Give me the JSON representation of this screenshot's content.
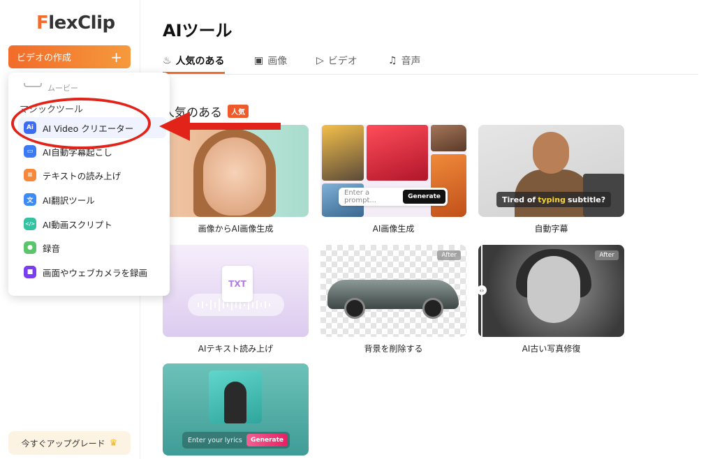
{
  "brand": {
    "logo_text": "lexClip",
    "logo_initial": "F"
  },
  "sidebar": {
    "create_label": "ビデオの作成",
    "create_icon": "plus-icon",
    "upgrade_label": "今すぐアップグレード",
    "upgrade_icon": "crown-icon"
  },
  "dropdown": {
    "movie_label": "ムービー",
    "section_label": "マジックツール",
    "items": [
      {
        "label": "AI Video クリエーター",
        "icon": "ai-video-icon",
        "color": "#3b6cf6",
        "glyph": "Ai"
      },
      {
        "label": "AI自動字幕起こし",
        "icon": "subtitle-icon",
        "color": "#3b7cf6",
        "glyph": "▭"
      },
      {
        "label": "テキストの読み上げ",
        "icon": "tts-icon",
        "color": "#f5883a",
        "glyph": "≡"
      },
      {
        "label": "AI翻訳ツール",
        "icon": "translate-icon",
        "color": "#3b8cf6",
        "glyph": "文"
      },
      {
        "label": "AI動画スクリプト",
        "icon": "script-icon",
        "color": "#35c2a2",
        "glyph": "</>"
      },
      {
        "label": "録音",
        "icon": "mic-icon",
        "color": "#5cc46a",
        "glyph": "●"
      },
      {
        "label": "画面やウェブカメラを録画",
        "icon": "screen-record-icon",
        "color": "#7a3df0",
        "glyph": "■"
      }
    ]
  },
  "main": {
    "title": "AIツール",
    "tabs": [
      {
        "label": "人気のある",
        "icon": "flame-icon"
      },
      {
        "label": "画像",
        "icon": "image-icon"
      },
      {
        "label": "ビデオ",
        "icon": "video-icon"
      },
      {
        "label": "音声",
        "icon": "music-icon"
      }
    ],
    "section_title": "人気のある",
    "section_badge": "人気",
    "cards": [
      {
        "label": "画像からAI画像生成"
      },
      {
        "label": "AI画像生成",
        "prompt_placeholder": "Enter a prompt...",
        "button": "Generate"
      },
      {
        "label": "自動字幕",
        "subtitle_pre": "Tired of",
        "subtitle_highlight": "typing",
        "subtitle_post": "subtitle?"
      },
      {
        "label": "AIテキスト読み上げ",
        "doc_text": "TXT"
      },
      {
        "label": "背景を削除する",
        "after": "After"
      },
      {
        "label": "AI古い写真修復",
        "after": "After"
      },
      {
        "lyrics_placeholder": "Enter your lyrics",
        "button": "Generate"
      }
    ]
  },
  "colors": {
    "brand": "#f26b2a",
    "annotation": "#e2231a"
  }
}
